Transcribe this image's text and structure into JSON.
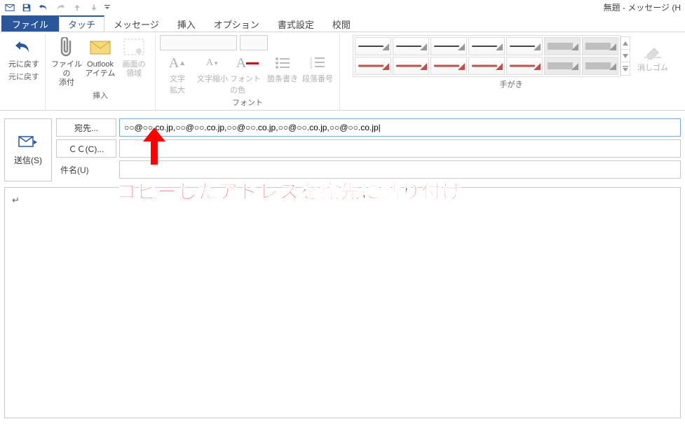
{
  "window_title": "無題 - メッセージ (H",
  "qat": {
    "undo_tip": "元に戻す"
  },
  "tabs": {
    "file": "ファイル",
    "touch": "タッチ",
    "message": "メッセージ",
    "insert": "挿入",
    "options": "オプション",
    "format": "書式設定",
    "review": "校閲"
  },
  "ribbon": {
    "undo": {
      "label": "元に戻す",
      "group": "元に戻す"
    },
    "insert": {
      "attach_file": "ファイルの\n添付",
      "outlook_item": "Outlook\nアイテム",
      "screenshot": "画面の\n領域",
      "group": "挿入"
    },
    "font": {
      "grow": "文字\n拡大",
      "shrink": "文字縮小",
      "color": "フォントの色",
      "bullets": "箇条書き",
      "numbering": "段落番号",
      "group": "フォント"
    },
    "ink": {
      "eraser": "消しゴム",
      "group": "手がき"
    }
  },
  "compose": {
    "send": "送信(S)",
    "to_btn": "宛先...",
    "cc_btn": "ＣＣ(C)...",
    "subject_label": "件名(U)",
    "to_value": "○○@○○.co.jp,○○@○○.co.jp,○○@○○.co.jp,○○@○○.co.jp,○○@○○.co.jp|"
  },
  "annotation": "コピーしたアドレスを宛先に貼り付け",
  "body_placeholder": "↵"
}
